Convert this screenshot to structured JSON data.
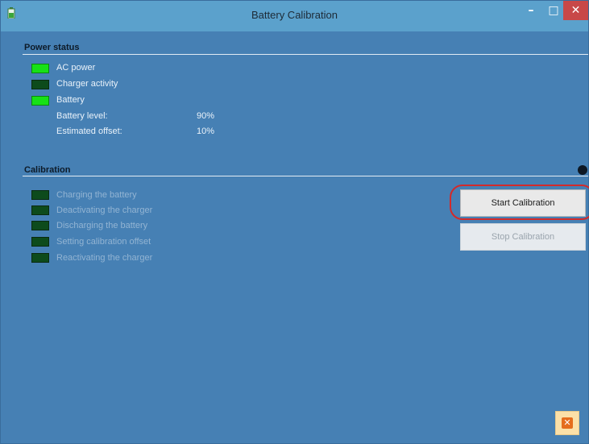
{
  "window": {
    "title": "Battery Calibration",
    "controls": {
      "minimize": "–",
      "maximize": "□",
      "close": "✕"
    }
  },
  "power_status": {
    "heading": "Power status",
    "indicators": [
      {
        "label": "AC power",
        "state": "on"
      },
      {
        "label": "Charger activity",
        "state": "off"
      },
      {
        "label": "Battery",
        "state": "on"
      }
    ],
    "readings": [
      {
        "label": "Battery level:",
        "value": "90%"
      },
      {
        "label": "Estimated offset:",
        "value": "10%"
      }
    ]
  },
  "calibration": {
    "heading": "Calibration",
    "steps": [
      {
        "label": "Charging the battery",
        "state": "off"
      },
      {
        "label": "Deactivating the charger",
        "state": "off"
      },
      {
        "label": "Discharging the battery",
        "state": "off"
      },
      {
        "label": "Setting calibration offset",
        "state": "off"
      },
      {
        "label": "Reactivating the charger",
        "state": "off"
      }
    ],
    "start_label": "Start Calibration",
    "stop_label": "Stop Calibration"
  },
  "footer": {
    "close_glyph": "✕"
  },
  "colors": {
    "background": "#4680b4",
    "titlebar": "#5ba1cc",
    "led_on": "#17e117",
    "led_off": "#0d4b1c",
    "highlight": "#d32a2a",
    "close": "#c84848"
  },
  "icons": [
    "battery-icon",
    "minimize-icon",
    "maximize-icon",
    "close-icon",
    "status-dot-icon",
    "close-app-icon"
  ]
}
